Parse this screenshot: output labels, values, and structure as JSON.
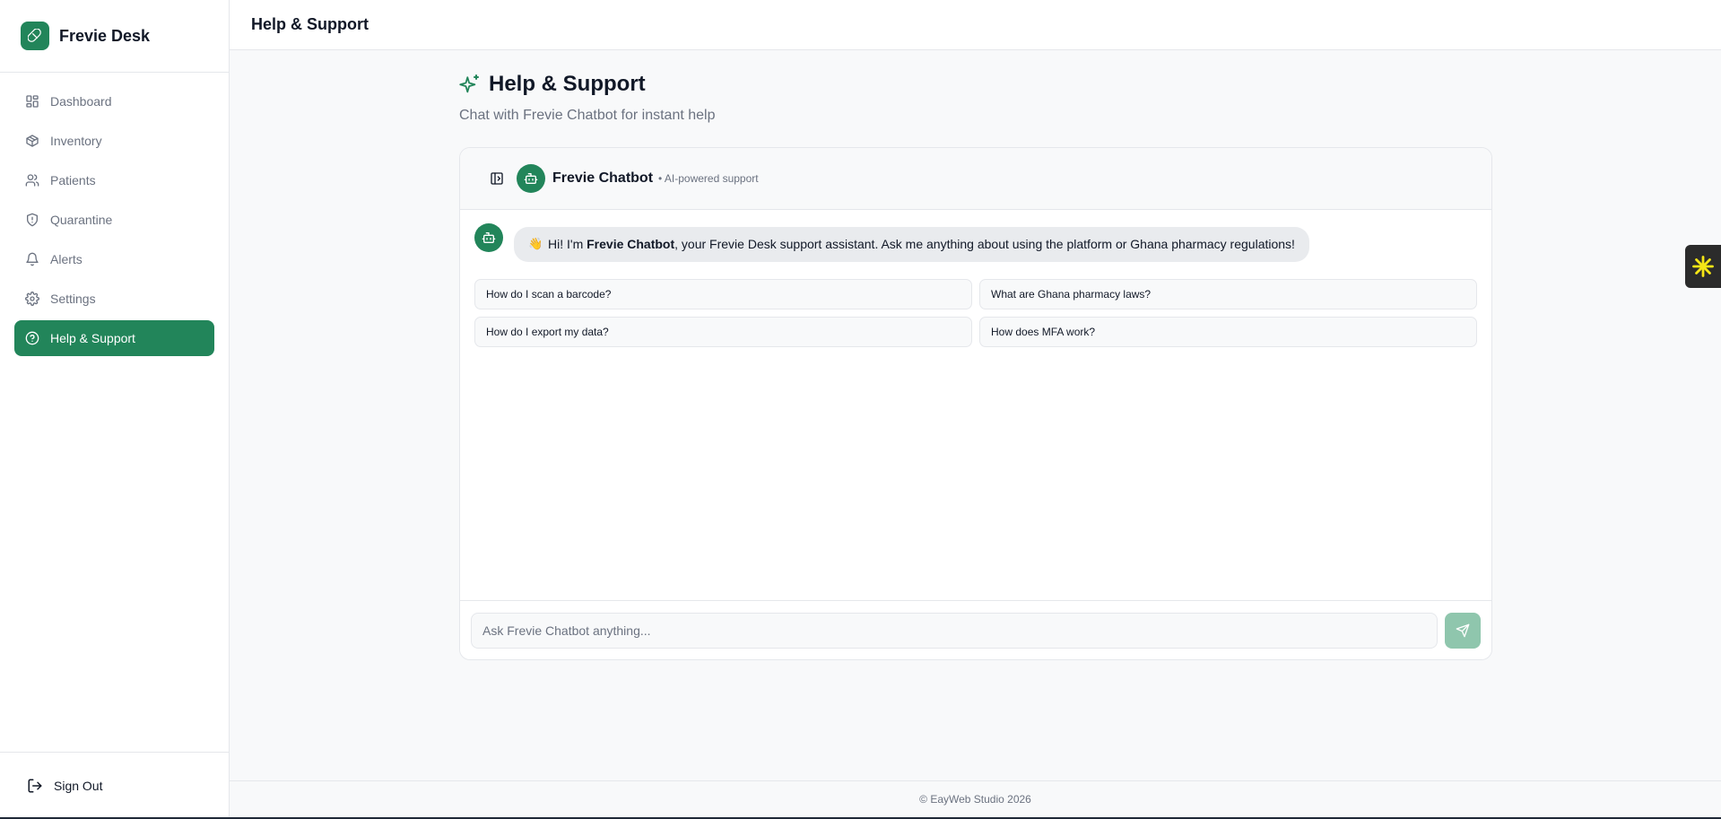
{
  "brand": {
    "name": "Frevie Desk",
    "icon": "pill-icon",
    "color": "#22855a"
  },
  "sidebar": {
    "items": [
      {
        "label": "Dashboard",
        "icon": "grid-icon",
        "active": false
      },
      {
        "label": "Inventory",
        "icon": "package-icon",
        "active": false
      },
      {
        "label": "Patients",
        "icon": "users-icon",
        "active": false
      },
      {
        "label": "Quarantine",
        "icon": "shield-alert-icon",
        "active": false
      },
      {
        "label": "Alerts",
        "icon": "bell-icon",
        "active": false
      },
      {
        "label": "Settings",
        "icon": "gear-icon",
        "active": false
      },
      {
        "label": "Help & Support",
        "icon": "help-circle-icon",
        "active": true
      }
    ],
    "sign_out": "Sign Out"
  },
  "header": {
    "title": "Help & Support"
  },
  "page": {
    "title": "Help & Support",
    "subtitle": "Chat with Frevie Chatbot for instant help"
  },
  "chat": {
    "bot_name": "Frevie Chatbot",
    "tagline": "• AI-powered support",
    "greeting": {
      "emoji": "👋",
      "before": "Hi! I'm ",
      "bold": "Frevie Chatbot",
      "after": ", your Frevie Desk support assistant. Ask me anything about using the platform or Ghana pharmacy regulations!"
    },
    "suggestions": [
      "How do I scan a barcode?",
      "What are Ghana pharmacy laws?",
      "How do I export my data?",
      "How does MFA work?"
    ],
    "input_placeholder": "Ask Frevie Chatbot anything..."
  },
  "footer": {
    "text": "© EayWeb Studio 2026"
  },
  "colors": {
    "accent": "#22855a",
    "send_disabled": "#8fc6ad",
    "widget": "#2b2b2b",
    "widget_icon": "#f5e616"
  }
}
